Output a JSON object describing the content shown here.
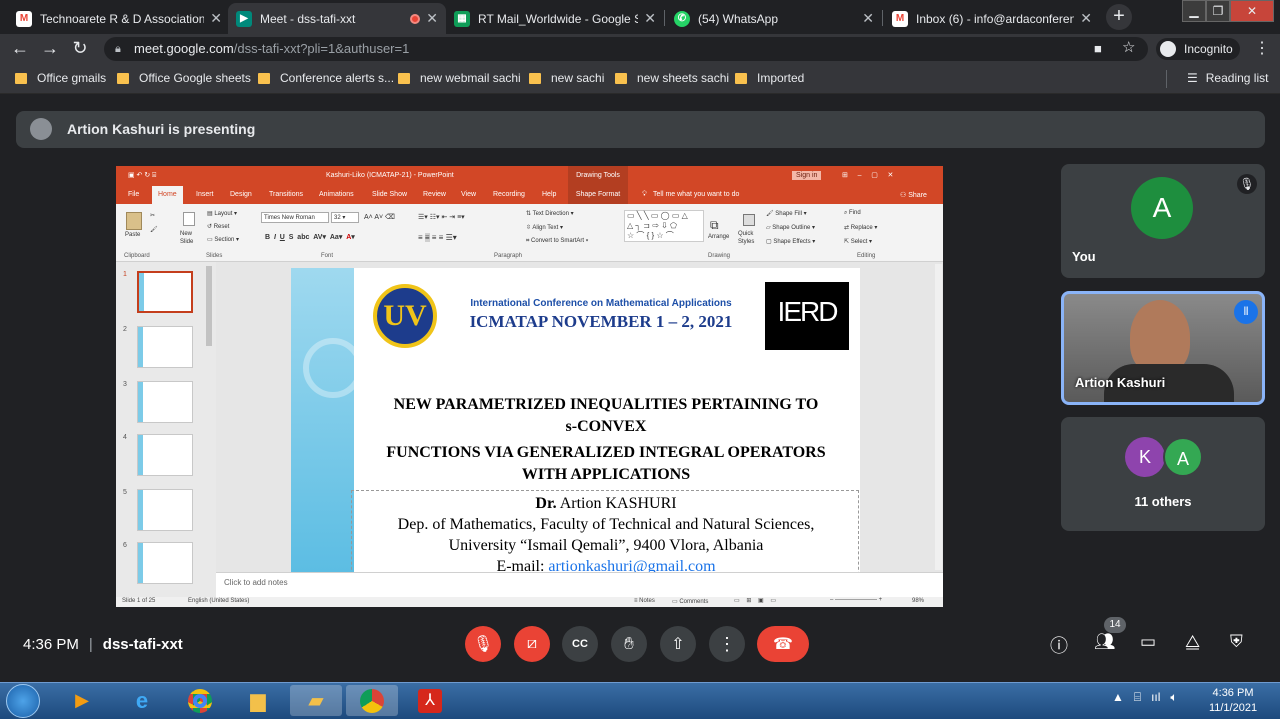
{
  "browser": {
    "tabs": [
      {
        "label": "Technoarete R & D Association",
        "icon": "gmail-icon"
      },
      {
        "label": "Meet - dss-tafi-xxt",
        "icon": "meet-icon",
        "active": true
      },
      {
        "label": "RT Mail_Worldwide - Google Sh",
        "icon": "sheets-icon"
      },
      {
        "label": "(54) WhatsApp",
        "icon": "whatsapp-icon"
      },
      {
        "label": "Inbox (6) - info@ardaconferenc",
        "icon": "gmail-icon"
      }
    ],
    "url_host": "meet.google.com",
    "url_path": "/dss-tafi-xxt?pli=1&authuser=1",
    "profile_label": "Incognito",
    "bookmarks": [
      "Office gmails",
      "Office Google sheets",
      "Conference alerts s...",
      "new webmail sachi",
      "new sachi",
      "new sheets sachi",
      "Imported"
    ],
    "reading_list": "Reading list"
  },
  "meet": {
    "presenting": "Artion Kashuri is presenting",
    "tiles": {
      "you_initial": "A",
      "you_label": "You",
      "speaker_label": "Artion Kashuri",
      "others_initials": [
        "K",
        "A"
      ],
      "others_label": "11 others"
    },
    "time": "4:36 PM",
    "sep": "|",
    "meeting_code": "dss-tafi-xxt",
    "participants_count": "14",
    "colors": {
      "end_call": "#ea4335",
      "you_avatar": "#1e8e3e",
      "k_avatar": "#8e44ad",
      "a_avatar": "#34a853",
      "speaker_outline": "#8ab4f8"
    }
  },
  "ppt": {
    "title": "Kashuri-Liko (ICMATAP-21) - PowerPoint",
    "drawing_tools": "Drawing Tools",
    "signin": "Sign in",
    "tabs": [
      "File",
      "Home",
      "Insert",
      "Design",
      "Transitions",
      "Animations",
      "Slide Show",
      "Review",
      "View",
      "Recording",
      "Help",
      "Shape Format"
    ],
    "tell_me": "Tell me what you want to do",
    "share": "Share",
    "ribbon": {
      "groups": [
        "Clipboard",
        "Slides",
        "Font",
        "Paragraph",
        "Drawing",
        "Editing"
      ],
      "paste": "Paste",
      "new_slide": "New Slide",
      "layout": "Layout",
      "reset": "Reset",
      "section": "Section",
      "font_name": "Times New Roman",
      "font_size": "32",
      "text_direction": "Text Direction",
      "align_text": "Align Text",
      "convert_smartart": "Convert to SmartArt",
      "arrange": "Arrange",
      "quick_styles": "Quick Styles",
      "shape_fill": "Shape Fill",
      "shape_outline": "Shape Outline",
      "shape_effects": "Shape Effects",
      "find": "Find",
      "replace": "Replace",
      "select": "Select"
    },
    "thumb_numbers": [
      "1",
      "2",
      "3",
      "4",
      "5",
      "6"
    ],
    "slide": {
      "conf_title": "International Conference on Mathematical Applications",
      "conf_line": "ICMATAP  NOVEMBER 1 – 2, 2021",
      "logo_uv": "UV",
      "logo_ierd": "IERD",
      "title_1": "NEW PARAMETRIZED INEQUALITIES PERTAINING TO",
      "title_2": "s-CONVEX",
      "title_3": "FUNCTIONS VIA GENERALIZED INTEGRAL OPERATORS",
      "title_4": "WITH APPLICATIONS",
      "author_prefix": "Dr.",
      "author": "Artion  KASHURI",
      "dept": "Dep. of Mathematics, Faculty of Technical and Natural Sciences,",
      "univ": "University “Ismail Qemali”, 9400 Vlora, Albania",
      "email_label": "E-mail:",
      "email": "artionkashuri@gmail.com"
    },
    "notes_placeholder": "Click to add notes",
    "status": {
      "slide": "Slide 1 of 25",
      "language": "English (United States)",
      "notes": "Notes",
      "comments": "Comments",
      "zoom": "98%"
    }
  },
  "taskbar": {
    "time": "4:36 PM",
    "date": "11/1/2021"
  }
}
